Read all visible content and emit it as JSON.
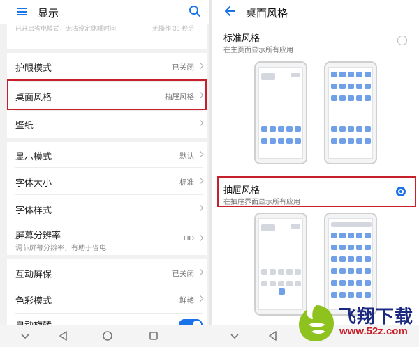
{
  "left": {
    "header": {
      "title": "显示"
    },
    "faded_notice": "已开启省电模式，无法设定休眠时间",
    "faded_value": "无操作 30 秒后",
    "items": [
      {
        "label": "护眼模式",
        "value": "已关闭"
      },
      {
        "label": "桌面风格",
        "value": "抽屉风格"
      },
      {
        "label": "壁纸",
        "value": ""
      },
      {
        "label": "显示模式",
        "value": "默认"
      },
      {
        "label": "字体大小",
        "value": "标准"
      },
      {
        "label": "字体样式",
        "value": ""
      },
      {
        "label": "屏幕分辨率",
        "value": "HD",
        "sub": "调节屏幕分辨率，有助于省电"
      },
      {
        "label": "互动屏保",
        "value": "已关闭"
      },
      {
        "label": "色彩模式",
        "value": "鲜艳"
      },
      {
        "label": "自动旋转",
        "toggle": true
      }
    ]
  },
  "right": {
    "header": {
      "title": "桌面风格"
    },
    "options": [
      {
        "title": "标准风格",
        "desc": "在主页面显示所有应用",
        "selected": false
      },
      {
        "title": "抽屉风格",
        "desc": "在抽屉界面显示所有应用",
        "selected": true
      }
    ]
  },
  "watermark": {
    "text": "飞翔下载",
    "url": "www.52z.com"
  },
  "colors": {
    "accent": "#1a73e8",
    "highlight": "#c8202a",
    "watermark_text": "#1b2a80"
  },
  "icons": [
    "menu-icon",
    "search-icon",
    "back-icon",
    "chevron-right-icon",
    "nav-collapse-icon",
    "nav-back-icon",
    "nav-home-icon",
    "nav-recent-icon"
  ]
}
